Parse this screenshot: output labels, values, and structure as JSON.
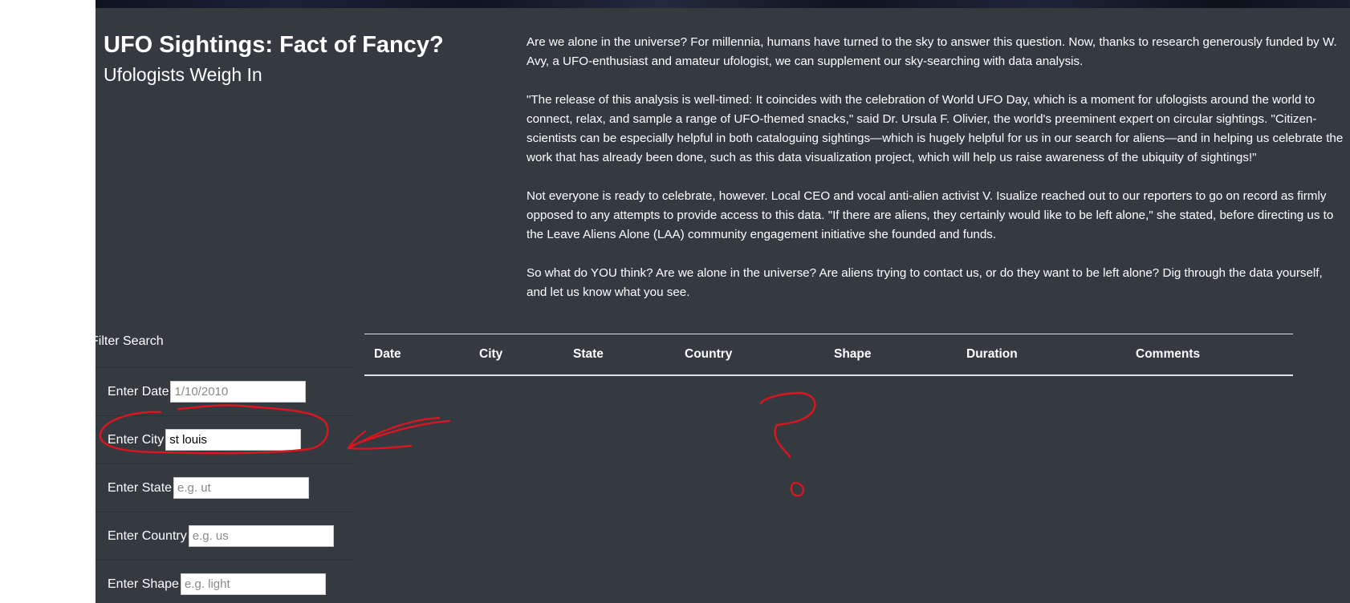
{
  "header": {
    "title": "UFO Sightings: Fact of Fancy?",
    "subtitle": "Ufologists Weigh In"
  },
  "article": {
    "paragraphs": [
      "Are we alone in the universe? For millennia, humans have turned to the sky to answer this question. Now, thanks to research generously funded by W. Avy, a UFO-enthusiast and amateur ufologist, we can supplement our sky-searching with data analysis.",
      "\"The release of this analysis is well-timed: It coincides with the celebration of World UFO Day, which is a moment for ufologists around the world to connect, relax, and sample a range of UFO-themed snacks,\" said Dr. Ursula F. Olivier, the world's preeminent expert on circular sightings. \"Citizen-scientists can be especially helpful in both cataloguing sightings—which is hugely helpful for us in our search for aliens—and in helping us celebrate the work that has already been done, such as this data visualization project, which will help us raise awareness of the ubiquity of sightings!\"",
      "Not everyone is ready to celebrate, however. Local CEO and vocal anti-alien activist V. Isualize reached out to our reporters to go on record as firmly opposed to any attempts to provide access to this data. \"If there are aliens, they certainly would like to be left alone,\" she stated, before directing us to the Leave Aliens Alone (LAA) community engagement initiative she founded and funds.",
      "So what do YOU think? Are we alone in the universe? Are aliens trying to contact us, or do they want to be left alone? Dig through the data yourself, and let us know what you see."
    ]
  },
  "filters": {
    "heading": "Filter Search",
    "date": {
      "label": "Enter Date",
      "value": "",
      "placeholder": "1/10/2010"
    },
    "city": {
      "label": "Enter City",
      "value": "st louis",
      "placeholder": ""
    },
    "state": {
      "label": "Enter State",
      "value": "",
      "placeholder": "e.g. ut"
    },
    "country": {
      "label": "Enter Country",
      "value": "",
      "placeholder": "e.g. us"
    },
    "shape": {
      "label": "Enter Shape",
      "value": "",
      "placeholder": "e.g. light"
    }
  },
  "table": {
    "headers": [
      "Date",
      "City",
      "State",
      "Country",
      "Shape",
      "Duration",
      "Comments"
    ]
  },
  "colors": {
    "page_background": "#343a40",
    "annotation_ink": "#e0141e"
  }
}
